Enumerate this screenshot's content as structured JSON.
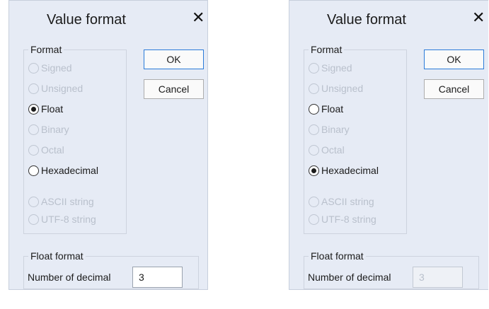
{
  "dialogs": [
    {
      "title": "Value format",
      "close_glyph": "✕",
      "format_legend": "Format",
      "options": [
        {
          "label": "Signed",
          "enabled": false,
          "selected": false
        },
        {
          "label": "Unsigned",
          "enabled": false,
          "selected": false
        },
        {
          "label": "Float",
          "enabled": true,
          "selected": true
        },
        {
          "label": "Binary",
          "enabled": false,
          "selected": false
        },
        {
          "label": "Octal",
          "enabled": false,
          "selected": false
        },
        {
          "label": "Hexadecimal",
          "enabled": true,
          "selected": false
        },
        {
          "label": "ASCII string",
          "enabled": false,
          "selected": false
        },
        {
          "label": "UTF-8 string",
          "enabled": false,
          "selected": false
        }
      ],
      "ok_label": "OK",
      "cancel_label": "Cancel",
      "float_legend": "Float format",
      "decimals_label": "Number of decimal",
      "decimals_value": "3",
      "decimals_enabled": true
    },
    {
      "title": "Value format",
      "close_glyph": "✕",
      "format_legend": "Format",
      "options": [
        {
          "label": "Signed",
          "enabled": false,
          "selected": false
        },
        {
          "label": "Unsigned",
          "enabled": false,
          "selected": false
        },
        {
          "label": "Float",
          "enabled": true,
          "selected": false
        },
        {
          "label": "Binary",
          "enabled": false,
          "selected": false
        },
        {
          "label": "Octal",
          "enabled": false,
          "selected": false
        },
        {
          "label": "Hexadecimal",
          "enabled": true,
          "selected": true
        },
        {
          "label": "ASCII string",
          "enabled": false,
          "selected": false
        },
        {
          "label": "UTF-8 string",
          "enabled": false,
          "selected": false
        }
      ],
      "ok_label": "OK",
      "cancel_label": "Cancel",
      "float_legend": "Float format",
      "decimals_label": "Number of decimal",
      "decimals_value": "3",
      "decimals_enabled": false
    }
  ],
  "colors": {
    "dialog_bg": "#e6ebf5",
    "disabled_text": "#b9c0cc",
    "ok_border": "#2b7bd9"
  }
}
